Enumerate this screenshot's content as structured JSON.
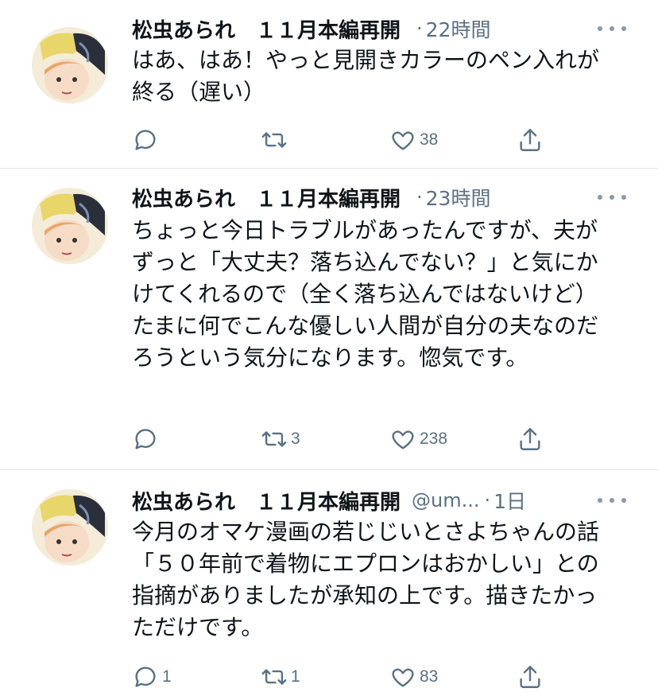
{
  "tweets": [
    {
      "name": "松虫あられ　１１月本編再開",
      "handle": "",
      "dot": "·",
      "time": "22時間",
      "text": "はあ、はあ！やっと見開きカラーのペン入れが終る（遅い）",
      "reply_count": "",
      "retweet_count": "",
      "like_count": "38"
    },
    {
      "name": "松虫あられ　１１月本編再開",
      "handle": "",
      "dot": "·",
      "time": "23時間",
      "text": "ちょっと今日トラブルがあったんですが、夫がずっと「大丈夫？落ち込んでない？」と気にかけてくれるので（全く落ち込んではないけど）たまに何でこんな優しい人間が自分の夫なのだろうという気分になります。惚気です。",
      "reply_count": "",
      "retweet_count": "3",
      "like_count": "238"
    },
    {
      "name": "松虫あられ　１１月本編再開",
      "handle": "@um...",
      "dot": "·",
      "time": "1日",
      "text": "今月のオマケ漫画の若じじいとさよちゃんの話「５０年前で着物にエプロンはおかしい」との指摘がありましたが承知の上です。描きたかっただけです。",
      "reply_count": "1",
      "retweet_count": "1",
      "like_count": "83"
    }
  ],
  "icons": {
    "reply": "reply-bubble-icon",
    "retweet": "retweet-arrows-icon",
    "like": "heart-icon",
    "share": "share-upload-icon",
    "more": "more-dots-icon"
  },
  "colors": {
    "text": "#0f1419",
    "secondary": "#5b7083",
    "divider": "#e1e6ea"
  }
}
